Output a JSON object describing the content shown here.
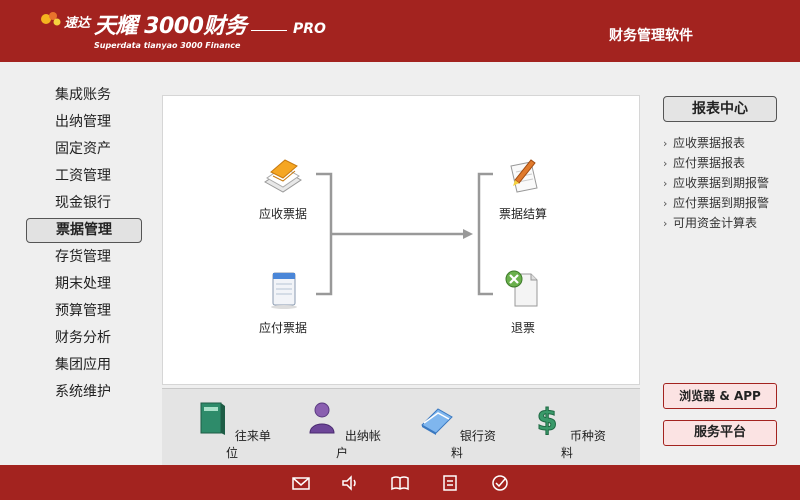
{
  "header": {
    "brand_prefix": "速达",
    "brand_main": "天耀 3000财务",
    "brand_sub": "Superdata tianyao 3000 Finance",
    "brand_pro": "PRO",
    "right_title": "财务管理软件"
  },
  "menu": {
    "items": [
      {
        "label": "集成账务"
      },
      {
        "label": "出纳管理"
      },
      {
        "label": "固定资产"
      },
      {
        "label": "工资管理"
      },
      {
        "label": "现金银行"
      },
      {
        "label": "票据管理",
        "active": true
      },
      {
        "label": "存货管理"
      },
      {
        "label": "期末处理"
      },
      {
        "label": "预算管理"
      },
      {
        "label": "财务分析"
      },
      {
        "label": "集团应用"
      },
      {
        "label": "系统维护"
      }
    ]
  },
  "flow": {
    "receivable": {
      "label": "应收票据",
      "icon": "receivable-notes-icon"
    },
    "payable": {
      "label": "应付票据",
      "icon": "payable-notes-icon"
    },
    "settle": {
      "label": "票据结算",
      "icon": "settlement-icon"
    },
    "refund": {
      "label": "退票",
      "icon": "refund-icon"
    }
  },
  "strip": {
    "items": [
      {
        "label": "往来单位",
        "icon": "partner-book-icon"
      },
      {
        "label": "出纳帐户",
        "icon": "cashier-account-icon"
      },
      {
        "label": "银行资料",
        "icon": "bank-data-icon"
      },
      {
        "label": "币种资料",
        "icon": "currency-icon"
      }
    ]
  },
  "reports": {
    "title": "报表中心",
    "items": [
      {
        "label": "应收票据报表"
      },
      {
        "label": "应付票据报表"
      },
      {
        "label": "应收票据到期报警"
      },
      {
        "label": "应付票据到期报警"
      },
      {
        "label": "可用资金计算表"
      }
    ]
  },
  "side_buttons": {
    "browser_app": "浏览器 & APP",
    "service": "服务平台"
  },
  "footer": {
    "icons": [
      "mail-icon",
      "speaker-icon",
      "book-icon",
      "window-icon",
      "check-icon"
    ]
  },
  "colors": {
    "brand": "#a3231f",
    "panel_bg": "#efefef"
  }
}
